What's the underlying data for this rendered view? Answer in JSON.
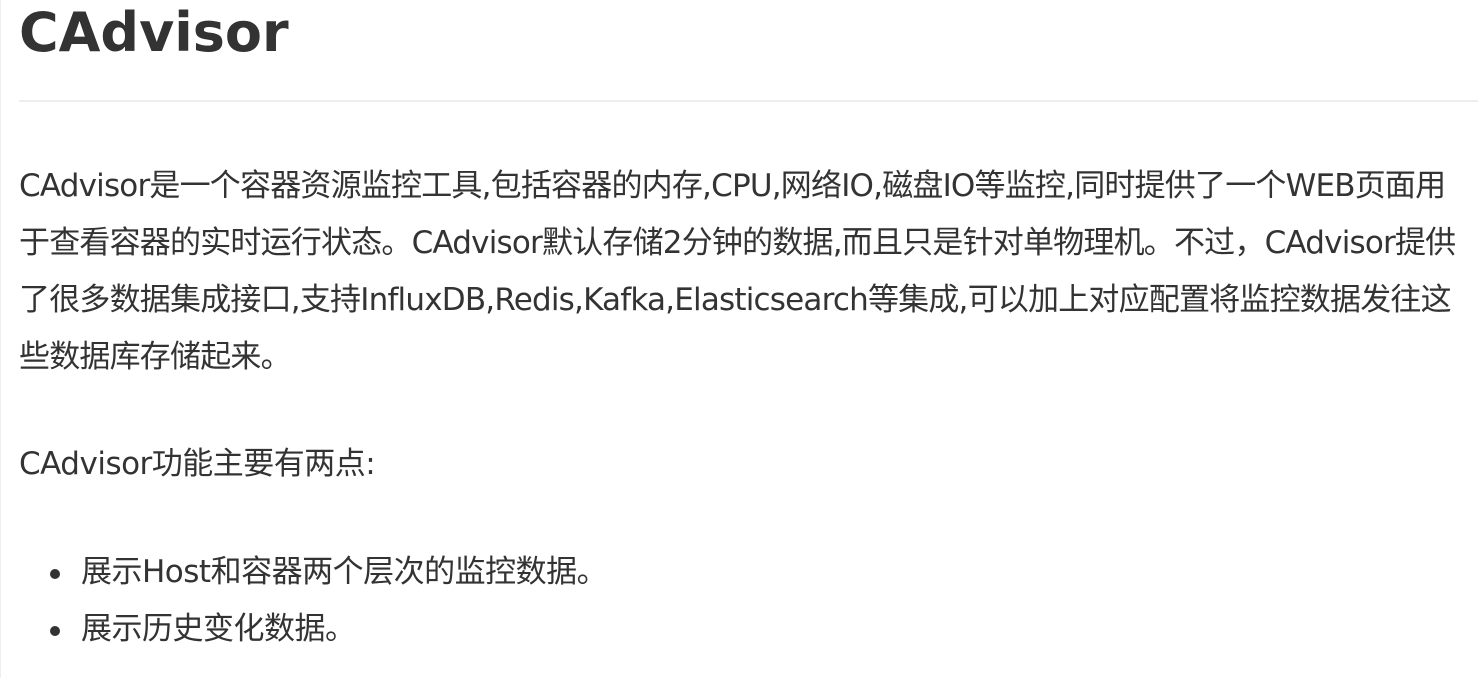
{
  "article": {
    "title": "CAdvisor",
    "intro": "CAdvisor是一个容器资源监控工具,包括容器的内存,CPU,网络IO,磁盘IO等监控,同时提供了一个WEB页面用于查看容器的实时运行状态。CAdvisor默认存储2分钟的数据,而且只是针对单物理机。不过，CAdvisor提供了很多数据集成接口,支持InfluxDB,Redis,Kafka,Elasticsearch等集成,可以加上对应配置将监控数据发往这些数据库存储起来。",
    "features_heading": "CAdvisor功能主要有两点:",
    "features": [
      "展示Host和容器两个层次的监控数据。",
      "展示历史变化数据。"
    ]
  }
}
